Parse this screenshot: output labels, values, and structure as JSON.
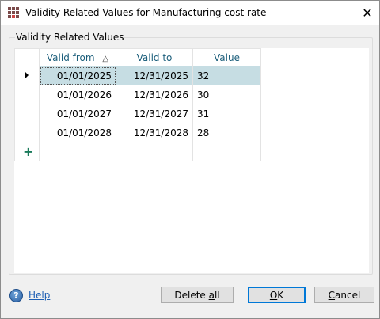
{
  "window": {
    "title": "Validity Related Values for Manufacturing cost rate",
    "close_glyph": "✕"
  },
  "group": {
    "label": "Validity Related Values"
  },
  "grid": {
    "columns": [
      "Valid from",
      "Valid to",
      "Value"
    ],
    "sort_indicator": "△",
    "rows": [
      {
        "valid_from": "01/01/2025",
        "valid_to": "12/31/2025",
        "value": "32"
      },
      {
        "valid_from": "01/01/2026",
        "valid_to": "12/31/2026",
        "value": "30"
      },
      {
        "valid_from": "01/01/2027",
        "valid_to": "12/31/2027",
        "value": "31"
      },
      {
        "valid_from": "01/01/2028",
        "valid_to": "12/31/2028",
        "value": "28"
      }
    ],
    "new_row_glyph": "+"
  },
  "footer": {
    "help_glyph": "?",
    "help_label": "Help",
    "delete_all_prefix": "Delete ",
    "delete_all_mnemonic": "a",
    "delete_all_suffix": "ll",
    "ok_mnemonic": "O",
    "ok_suffix": "K",
    "cancel_mnemonic": "C",
    "cancel_suffix": "ancel"
  },
  "colors": {
    "header_text": "#1b5e7b",
    "selected_row": "#c6dde3",
    "accent": "#0078d7",
    "link": "#1e5fb4"
  }
}
